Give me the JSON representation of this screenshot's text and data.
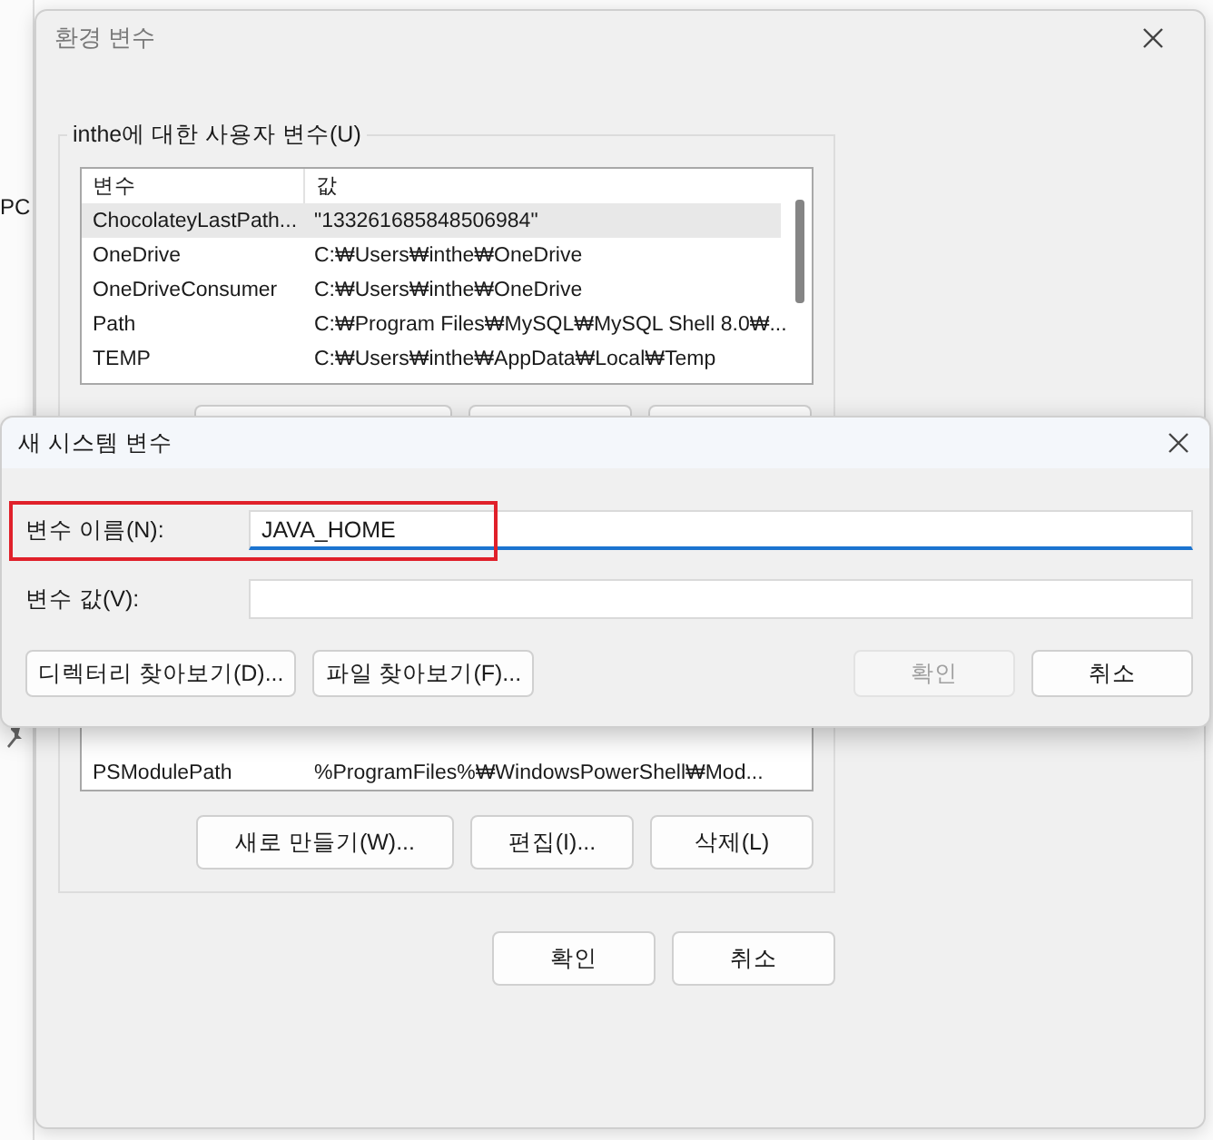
{
  "background": {
    "side_text": "PC"
  },
  "env_dialog": {
    "title": "환경 변수",
    "user_group": {
      "title": "inthe에 대한 사용자 변수(U)",
      "columns": [
        "변수",
        "값"
      ],
      "rows": [
        {
          "name": "ChocolateyLastPath...",
          "value": "\"133261685848506984\"",
          "selected": true
        },
        {
          "name": "OneDrive",
          "value": "C:₩Users₩inthe₩OneDrive",
          "selected": false
        },
        {
          "name": "OneDriveConsumer",
          "value": "C:₩Users₩inthe₩OneDrive",
          "selected": false
        },
        {
          "name": "Path",
          "value": "C:₩Program Files₩MySQL₩MySQL Shell 8.0₩...",
          "selected": false
        },
        {
          "name": "TEMP",
          "value": "C:₩Users₩inthe₩AppData₩Local₩Temp",
          "selected": false
        }
      ]
    },
    "system_group": {
      "rows": [
        {
          "name": "PSModulePath",
          "value": "%ProgramFiles%₩WindowsPowerShell₩Mod...",
          "selected": false
        }
      ],
      "buttons": [
        "새로 만들기(W)...",
        "편집(I)...",
        "삭제(L)"
      ]
    },
    "buttons": [
      "확인",
      "취소"
    ]
  },
  "new_var_dialog": {
    "title": "새 시스템 변수",
    "fields": [
      {
        "label": "변수 이름(N):",
        "value": "JAVA_HOME",
        "focused": true,
        "highlighted": true
      },
      {
        "label": "변수 값(V):",
        "focused": false,
        "highlighted": false
      }
    ],
    "buttons": [
      {
        "label": "디렉터리 찾아보기(D)...",
        "kind": "left",
        "disabled": false
      },
      {
        "label": "파일 찾아보기(F)...",
        "kind": "left",
        "disabled": false
      },
      {
        "label": "확인",
        "kind": "right",
        "disabled": true
      },
      {
        "label": "취소",
        "kind": "right",
        "disabled": false
      }
    ]
  }
}
